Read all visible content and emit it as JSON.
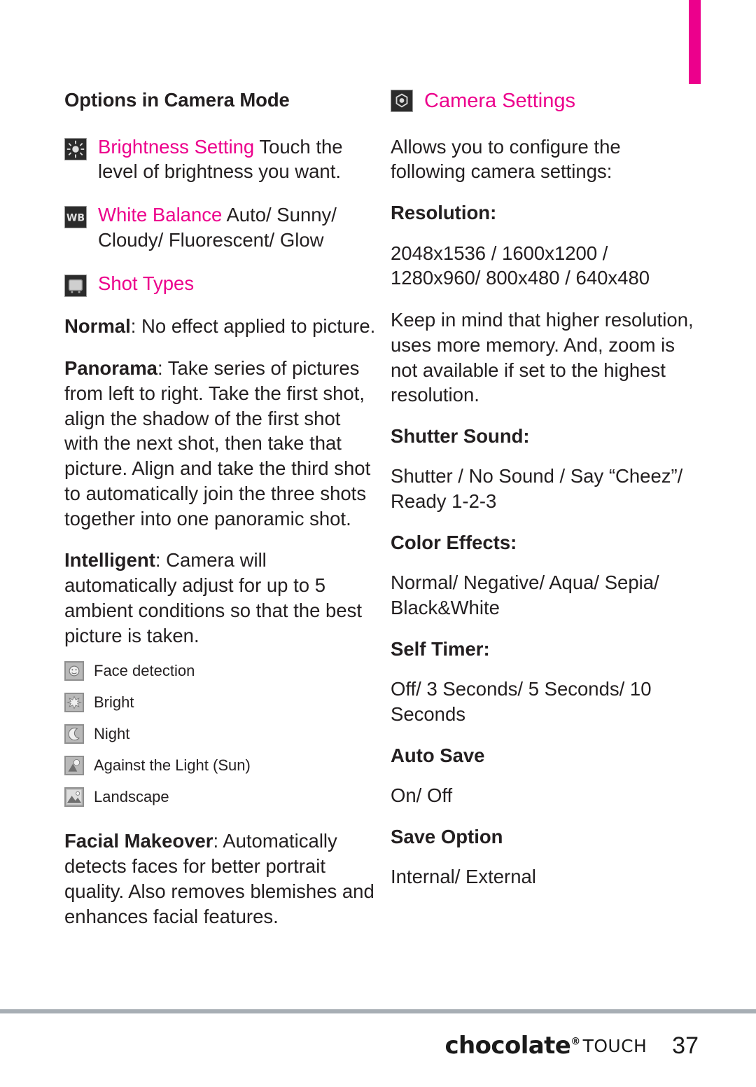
{
  "page": {
    "number": "37",
    "brand": "chocolate",
    "brand_registered": "®",
    "brand_suffix": "TOUCH"
  },
  "tab_marker": {
    "color": "#ec008c"
  },
  "left_column": {
    "heading": "Options in Camera Mode",
    "entries": [
      {
        "icon": "brightness-icon",
        "title": "Brightness Setting",
        "title_color": "#ec008c",
        "body": " Touch the level of brightness you want."
      },
      {
        "icon": "white-balance-icon",
        "title": "White Balance",
        "title_color": "#ec008c",
        "body": "  Auto/ Sunny/ Cloudy/ Fluorescent/ Glow"
      },
      {
        "icon": "shot-types-icon",
        "title": "Shot Types",
        "title_color": "#ec008c",
        "body": ""
      }
    ],
    "shot_types": [
      {
        "term": "Normal",
        "sep": ": ",
        "definition": "No effect applied to picture."
      },
      {
        "term": "Panorama",
        "sep": ": ",
        "definition": "Take series of pictures from left to right. Take the first shot, align the shadow of the first shot with the next shot, then take that picture. Align and take the third shot to automatically join the three shots together into one panoramic shot."
      },
      {
        "term": "Intelligent",
        "sep": ": ",
        "definition": "Camera will automatically adjust for up to 5 ambient conditions so that the best picture is taken."
      }
    ],
    "scene_modes": [
      {
        "icon": "face-detection-icon",
        "label": "Face detection"
      },
      {
        "icon": "bright-icon",
        "label": "Bright"
      },
      {
        "icon": "night-icon",
        "label": "Night"
      },
      {
        "icon": "against-the-light-icon",
        "label": "Against the Light (Sun)"
      },
      {
        "icon": "landscape-icon",
        "label": "Landscape"
      }
    ],
    "facial_makeover": {
      "term": "Facial Makeover",
      "sep": ": ",
      "definition": "Automatically detects faces for better portrait quality. Also removes blemishes and enhances facial features."
    }
  },
  "right_column": {
    "heading_icon": "camera-settings-icon",
    "heading": "Camera Settings",
    "heading_color": "#ec008c",
    "intro": "Allows you to configure the following camera settings:",
    "settings": [
      {
        "label": "Resolution:",
        "values": "2048x1536 / 1600x1200 / 1280x960/ 800x480 / 640x480",
        "note": "Keep in mind that higher resolution, uses more memory. And, zoom is not available if set to the highest resolution."
      },
      {
        "label": "Shutter Sound:",
        "values": "Shutter / No Sound / Say “Cheez”/ Ready 1-2-3",
        "note": ""
      },
      {
        "label": "Color Effects:",
        "values": "Normal/ Negative/ Aqua/ Sepia/ Black&White",
        "note": ""
      },
      {
        "label": "Self Timer:",
        "values": "Off/ 3 Seconds/ 5 Seconds/ 10 Seconds",
        "note": ""
      },
      {
        "label": "Auto Save",
        "values": "On/ Off",
        "note": ""
      },
      {
        "label": "Save Option",
        "values": "Internal/ External",
        "note": ""
      }
    ]
  }
}
